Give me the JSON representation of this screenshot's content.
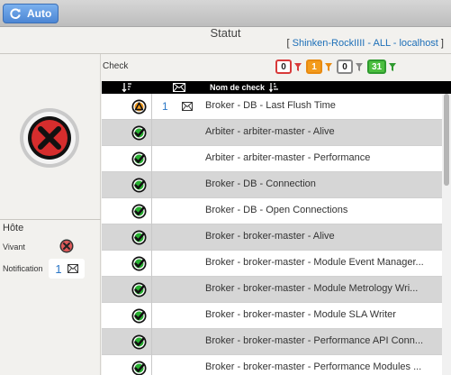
{
  "toolbar": {
    "auto_label": "Auto"
  },
  "header": {
    "title": "Statut",
    "realm_prefix": "[ ",
    "realm_link": "Shinken-RockIIII - ALL - localhost",
    "realm_suffix": " ]"
  },
  "host": {
    "section_label": "Hôte",
    "alive_label": "Vivant",
    "notification_label": "Notification",
    "notification_count": "1",
    "status": "critical"
  },
  "checks": {
    "label": "Check",
    "counters": [
      {
        "value": "0",
        "kind": "critical"
      },
      {
        "value": "1",
        "kind": "warning"
      },
      {
        "value": "0",
        "kind": "unknown"
      },
      {
        "value": "31",
        "kind": "ok"
      }
    ],
    "columns": {
      "name": "Nom de check"
    },
    "rows": [
      {
        "status": "warning",
        "notif": "1",
        "has_mail": true,
        "name": "Broker - DB - Last Flush Time"
      },
      {
        "status": "ok",
        "notif": "",
        "has_mail": false,
        "name": "Arbiter - arbiter-master - Alive"
      },
      {
        "status": "ok",
        "notif": "",
        "has_mail": false,
        "name": "Arbiter - arbiter-master - Performance"
      },
      {
        "status": "ok",
        "notif": "",
        "has_mail": false,
        "name": "Broker - DB - Connection"
      },
      {
        "status": "ok",
        "notif": "",
        "has_mail": false,
        "name": "Broker - DB - Open Connections"
      },
      {
        "status": "ok",
        "notif": "",
        "has_mail": false,
        "name": "Broker - broker-master - Alive"
      },
      {
        "status": "ok",
        "notif": "",
        "has_mail": false,
        "name": "Broker - broker-master - Module Event Manager..."
      },
      {
        "status": "ok",
        "notif": "",
        "has_mail": false,
        "name": "Broker - broker-master - Module Metrology Wri..."
      },
      {
        "status": "ok",
        "notif": "",
        "has_mail": false,
        "name": "Broker - broker-master - Module SLA Writer"
      },
      {
        "status": "ok",
        "notif": "",
        "has_mail": false,
        "name": "Broker - broker-master - Performance API Conn..."
      },
      {
        "status": "ok",
        "notif": "",
        "has_mail": false,
        "name": "Broker - broker-master - Performance Modules ..."
      }
    ]
  },
  "colors": {
    "critical": "#d62d2d",
    "warning": "#f39b1c",
    "ok": "#27b030",
    "link": "#1d6fb8",
    "auto_button": "#5b93dc"
  }
}
